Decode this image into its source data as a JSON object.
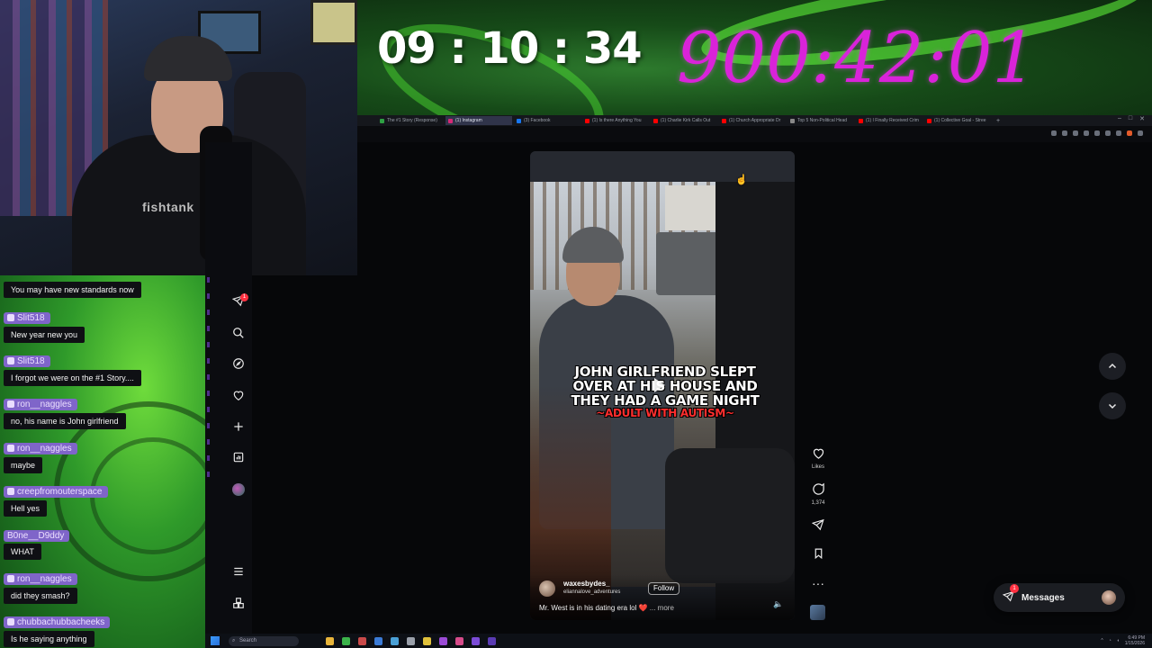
{
  "banner": {
    "timer_left": "09 : 10 : 34",
    "timer_right": "900:42:01"
  },
  "webcam": {
    "shirt_text": "fishtank"
  },
  "browser": {
    "tabs": [
      {
        "label": "The #1 Story (Response)",
        "color": "#2ea043"
      },
      {
        "label": "(1) Instagram",
        "color": "#d62976",
        "active": true
      },
      {
        "label": "(3) Facebook",
        "color": "#1877f2"
      },
      {
        "label": "(1) Is there Anything You",
        "color": "#ff0000"
      },
      {
        "label": "(1) Charlie Kirk Calls Out",
        "color": "#ff0000"
      },
      {
        "label": "(1) Church Appropriate Dr",
        "color": "#ff0000"
      },
      {
        "label": "Top 5 Non-Political Head",
        "color": "#888888"
      },
      {
        "label": "(1) I Finally Received Crim",
        "color": "#ff0000"
      },
      {
        "label": "(1) Collective Goal - Stree",
        "color": "#ff0000"
      }
    ],
    "new_tab": "+"
  },
  "chat": {
    "messages": [
      {
        "user": "",
        "text": "You may have new standards now"
      },
      {
        "user": "Slit518",
        "text": "New year new you"
      },
      {
        "user": "Slit518",
        "text": "I forgot we were on the #1 Story...."
      },
      {
        "user": "ron__naggles",
        "text": "no, his name is John girlfriend"
      },
      {
        "user": "ron__naggles",
        "text": "maybe"
      },
      {
        "user": "creepfromouterspace",
        "text": "Hell yes"
      },
      {
        "user": "B0ne__D9ddy",
        "text": "WHAT"
      },
      {
        "user": "ron__naggles",
        "text": "did they smash?"
      },
      {
        "user": "chubbachubbacheeks",
        "text": "Is he saying anything"
      }
    ]
  },
  "instagram": {
    "nav": {
      "notifications_badge": "1"
    },
    "reel": {
      "caption_line1": "JOHN GIRLFRIEND SLEPT",
      "caption_line2": "OVER AT HIS HOUSE AND",
      "caption_line3": "THEY HAD A GAME NIGHT",
      "caption_sub": "~ADULT WITH AUTISM~",
      "author": "waxesbydes_",
      "author_sub": "eliannalove_adventures",
      "follow_label": "Follow",
      "description": "Mr. West is in his dating era lol",
      "more_label": "... more"
    },
    "actions": {
      "likes_label": "Likes",
      "comments_count": "1,374"
    },
    "messages": {
      "label": "Messages",
      "badge": "1"
    }
  },
  "taskbar": {
    "search_placeholder": "Search",
    "clock_time": "6:49 PM",
    "clock_date": "1/15/2026"
  }
}
